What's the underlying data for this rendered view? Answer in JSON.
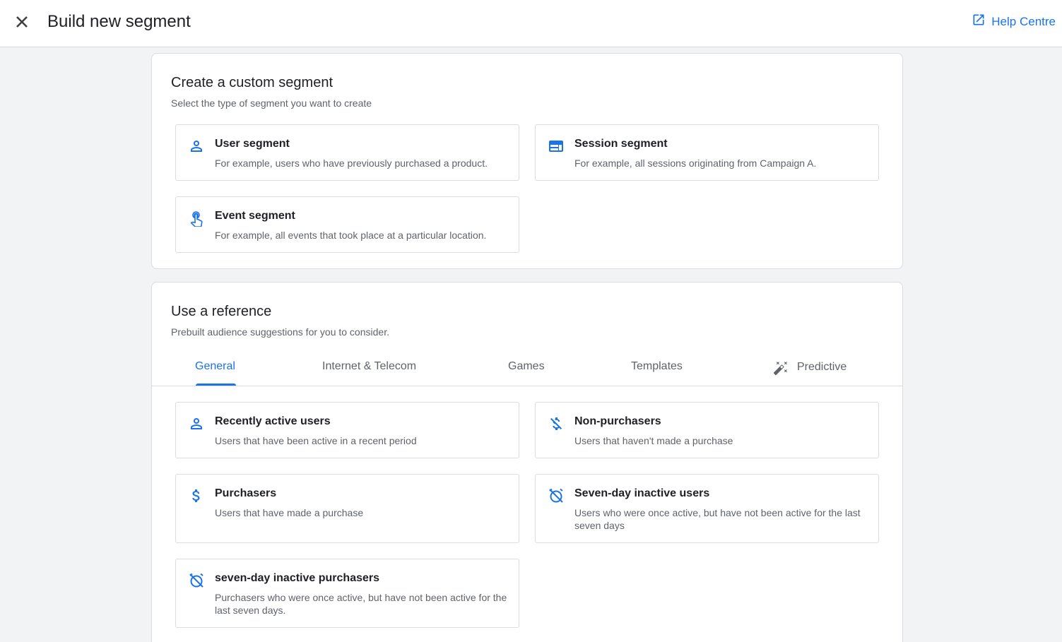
{
  "header": {
    "title": "Build new segment",
    "help_label": "Help Centre"
  },
  "custom": {
    "title": "Create a custom segment",
    "subtitle": "Select the type of segment you want to create",
    "options": [
      {
        "title": "User segment",
        "desc": "For example, users who have previously purchased a product.",
        "icon": "person-icon"
      },
      {
        "title": "Session segment",
        "desc": "For example, all sessions originating from Campaign A.",
        "icon": "session-icon"
      },
      {
        "title": "Event segment",
        "desc": "For example, all events that took place at a particular location.",
        "icon": "touch-icon"
      }
    ]
  },
  "reference": {
    "title": "Use a reference",
    "subtitle": "Prebuilt audience suggestions for you to consider.",
    "tabs": [
      "General",
      "Internet & Telecom",
      "Games",
      "Templates",
      "Predictive"
    ],
    "active_tab": "General",
    "options": [
      {
        "title": "Recently active users",
        "desc": "Users that have been active in a recent period",
        "icon": "person-icon"
      },
      {
        "title": "Non-purchasers",
        "desc": "Users that haven't made a purchase",
        "icon": "money-off-icon"
      },
      {
        "title": "Purchasers",
        "desc": "Users that have made a purchase",
        "icon": "dollar-icon"
      },
      {
        "title": "Seven-day inactive users",
        "desc": "Users who were once active, but have not been active for the last seven days",
        "icon": "alarm-off-icon"
      },
      {
        "title": "seven-day inactive purchasers",
        "desc": "Purchasers who were once active, but have not been active for the last seven days.",
        "icon": "alarm-off-icon"
      }
    ]
  },
  "colors": {
    "accent": "#1a73e8",
    "icon_blue": "#1a73e8",
    "text_primary": "#202124",
    "text_secondary": "#5f6368",
    "border": "#dadce0",
    "background": "#f1f3f4"
  }
}
